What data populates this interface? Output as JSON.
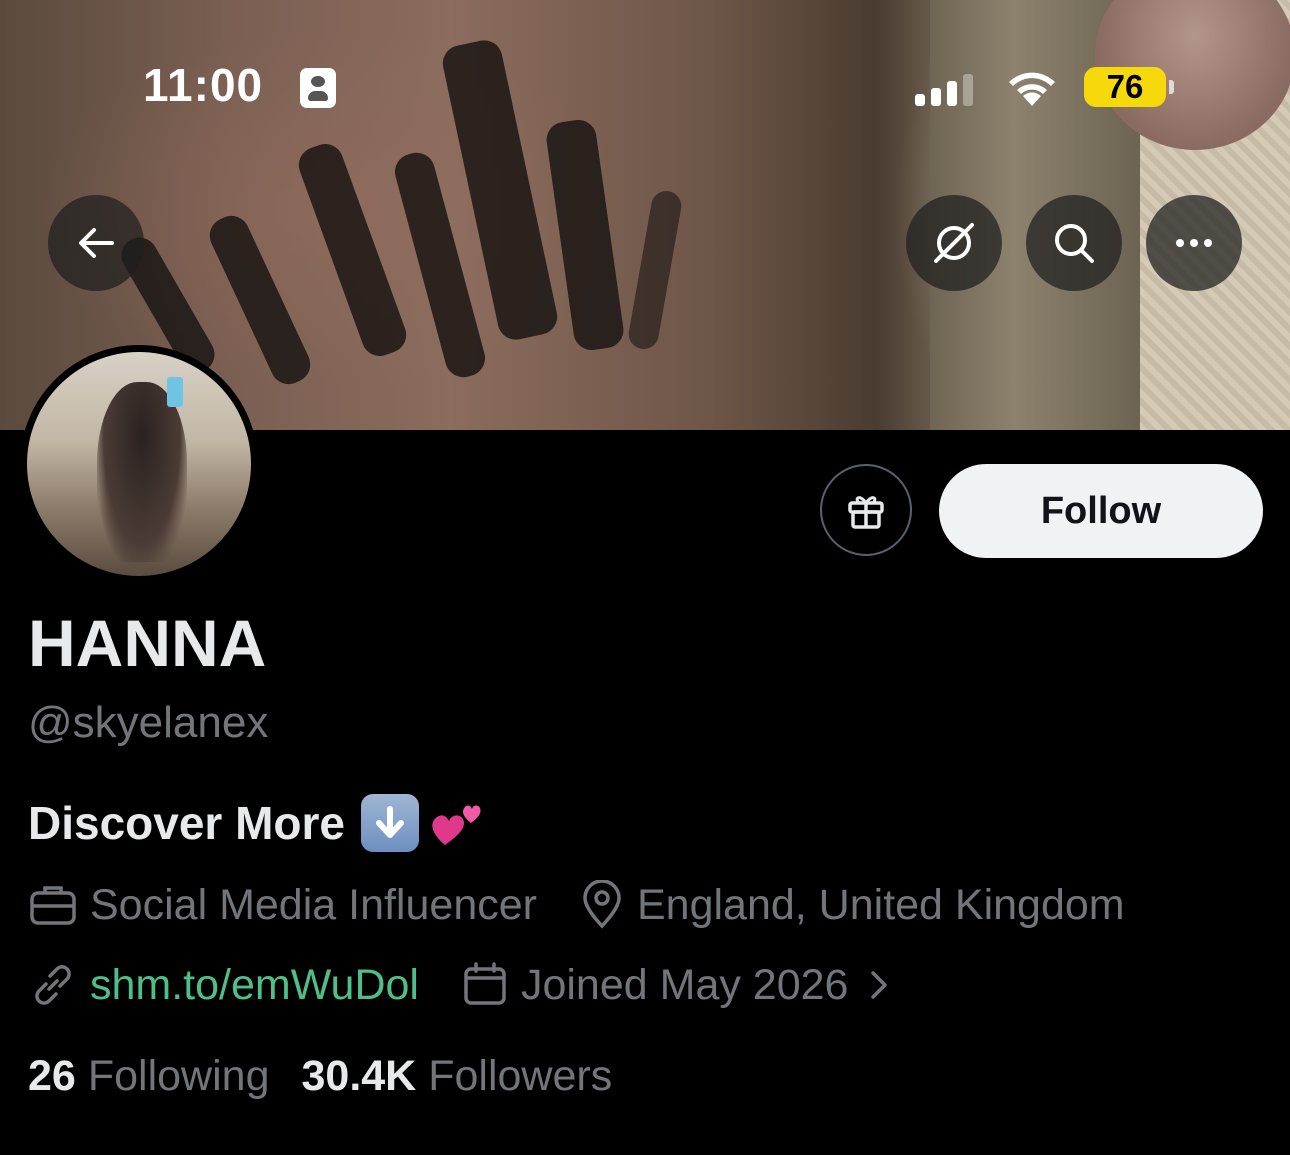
{
  "status_bar": {
    "time": "11:00",
    "battery": "76",
    "battery_color": "#f5d90a"
  },
  "profile": {
    "display_name": "HANNA",
    "handle": "@skyelanex",
    "bio": "Discover More",
    "bio_emojis": [
      "down-arrow-emoji",
      "two-hearts-emoji"
    ],
    "category": "Social Media Influencer",
    "location": "England, United Kingdom",
    "link": "shm.to/emWuDol",
    "joined": "Joined May 2026",
    "following_count": "26",
    "following_label": "Following",
    "followers_count": "30.4K",
    "followers_label": "Followers"
  },
  "actions": {
    "follow_label": "Follow"
  },
  "colors": {
    "background": "#000000",
    "primary_text": "#e7e9ea",
    "secondary_text": "#71767b",
    "link": "#4fbf8a",
    "follow_button_bg": "#eff3f4"
  },
  "icons": [
    "back-arrow-icon",
    "grok-icon",
    "search-icon",
    "more-icon",
    "gift-icon",
    "briefcase-icon",
    "location-pin-icon",
    "link-icon",
    "calendar-icon",
    "chevron-right-icon"
  ]
}
